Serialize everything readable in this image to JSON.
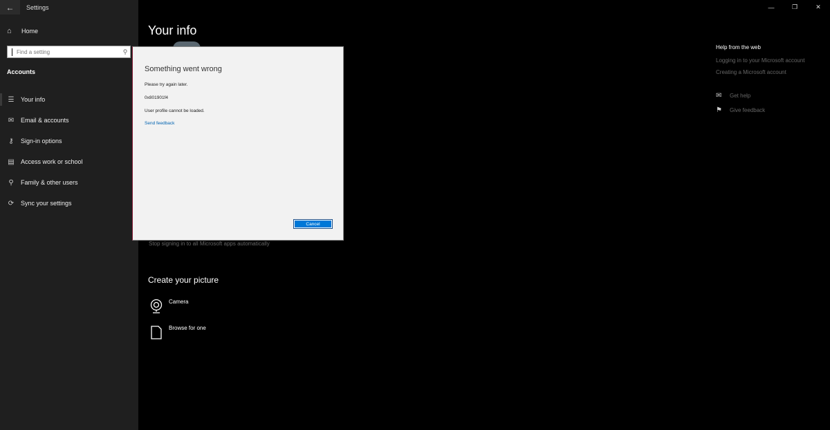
{
  "window": {
    "title": "Settings"
  },
  "sidebar": {
    "home_label": "Home",
    "search_placeholder": "Find a setting",
    "section": "Accounts",
    "items": [
      {
        "label": "Your info",
        "icon": "contact-card-icon"
      },
      {
        "label": "Email & accounts",
        "icon": "mail-icon"
      },
      {
        "label": "Sign-in options",
        "icon": "key-icon"
      },
      {
        "label": "Access work or school",
        "icon": "briefcase-icon"
      },
      {
        "label": "Family & other users",
        "icon": "person-add-icon"
      },
      {
        "label": "Sync your settings",
        "icon": "sync-icon"
      }
    ]
  },
  "main": {
    "title": "Your info",
    "stop_signing_link": "Stop signing in to all Microsoft apps automatically",
    "create_picture_title": "Create your picture",
    "picture_options": [
      {
        "label": "Camera",
        "icon": "camera-icon"
      },
      {
        "label": "Browse for one",
        "icon": "browse-file-icon"
      }
    ]
  },
  "help": {
    "title": "Help from the web",
    "links": [
      "Logging in to your Microsoft account",
      "Creating a Microsoft account"
    ],
    "get_help": "Get help",
    "give_feedback": "Give feedback"
  },
  "dialog": {
    "title": "Something went wrong",
    "message": "Please try again later.",
    "error_code": "0x801901f4",
    "detail": "User profile cannot be loaded.",
    "feedback_link": "Send feedback",
    "cancel_label": "Cancel"
  },
  "colors": {
    "accent": "#0078d7",
    "link": "#0063b1",
    "sidebar_bg": "#1f1f1f",
    "main_bg": "#000000",
    "dialog_bg": "#f2f2f2"
  }
}
